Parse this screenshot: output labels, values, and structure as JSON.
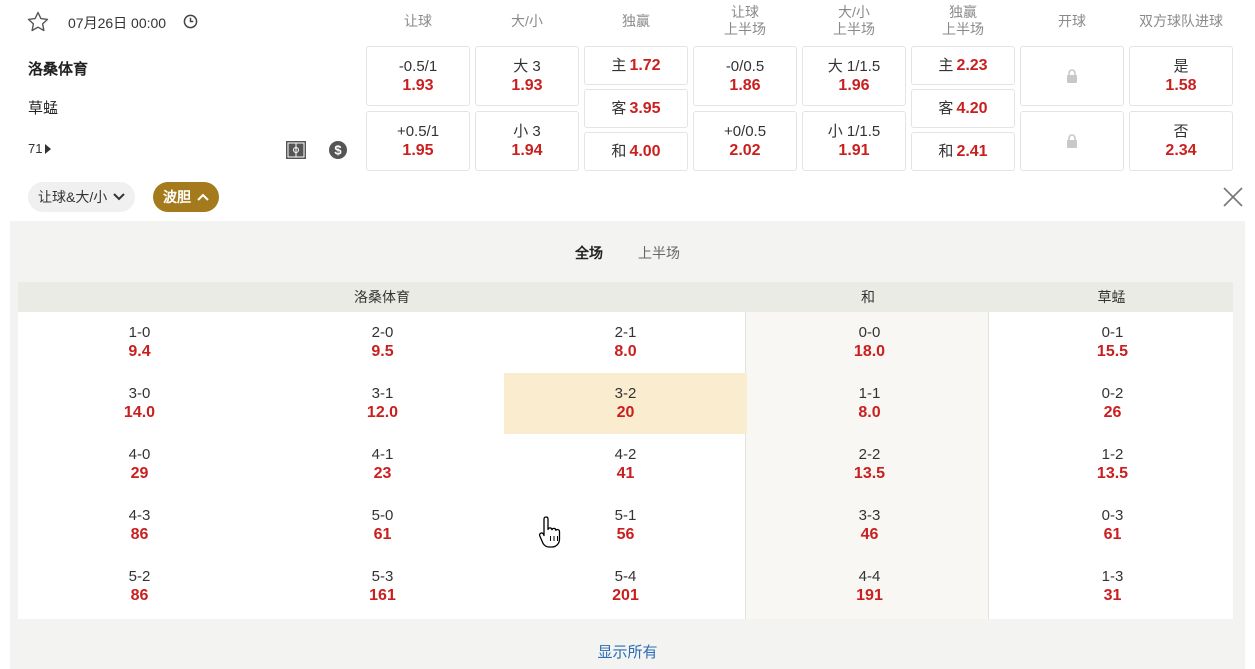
{
  "match": {
    "datetime": "07月26日 00:00",
    "home_team": "洛桑体育",
    "away_team": "草蜢",
    "more_markets_count": "71"
  },
  "columns": {
    "handicap": "让球",
    "total": "大/小",
    "moneyline": "独赢",
    "handicap_1h_a": "让球",
    "handicap_1h_b": "上半场",
    "total_1h_a": "大/小",
    "total_1h_b": "上半场",
    "moneyline_1h_a": "独赢",
    "moneyline_1h_b": "上半场",
    "kickoff": "开球",
    "btts": "双方球队进球"
  },
  "odds": {
    "handicap": [
      {
        "line": "-0.5/1",
        "odd": "1.93"
      },
      {
        "line": "+0.5/1",
        "odd": "1.95"
      }
    ],
    "total": [
      {
        "line": "大 3",
        "odd": "1.93"
      },
      {
        "line": "小 3",
        "odd": "1.94"
      }
    ],
    "moneyline": [
      {
        "line": "主",
        "odd": "1.72"
      },
      {
        "line": "客",
        "odd": "3.95"
      },
      {
        "line": "和",
        "odd": "4.00"
      }
    ],
    "handicap_1h": [
      {
        "line": "-0/0.5",
        "odd": "1.86"
      },
      {
        "line": "+0/0.5",
        "odd": "2.02"
      }
    ],
    "total_1h": [
      {
        "line": "大 1/1.5",
        "odd": "1.96"
      },
      {
        "line": "小 1/1.5",
        "odd": "1.91"
      }
    ],
    "moneyline_1h": [
      {
        "line": "主",
        "odd": "2.23"
      },
      {
        "line": "客",
        "odd": "4.20"
      },
      {
        "line": "和",
        "odd": "2.41"
      }
    ],
    "btts": [
      {
        "line": "是",
        "odd": "1.58"
      },
      {
        "line": "否",
        "odd": "2.34"
      }
    ]
  },
  "chips": {
    "chip1": "让球&大/小",
    "chip2": "波胆"
  },
  "period_tabs": {
    "full": "全场",
    "first_half": "上半场"
  },
  "correct_score": {
    "header_home": "洛桑体育",
    "header_draw": "和",
    "header_away": "草蜢",
    "home": [
      [
        {
          "s": "1-0",
          "o": "9.4"
        },
        {
          "s": "2-0",
          "o": "9.5"
        },
        {
          "s": "2-1",
          "o": "8.0"
        }
      ],
      [
        {
          "s": "3-0",
          "o": "14.0"
        },
        {
          "s": "3-1",
          "o": "12.0"
        },
        {
          "s": "3-2",
          "o": "20"
        }
      ],
      [
        {
          "s": "4-0",
          "o": "29"
        },
        {
          "s": "4-1",
          "o": "23"
        },
        {
          "s": "4-2",
          "o": "41"
        }
      ],
      [
        {
          "s": "4-3",
          "o": "86"
        },
        {
          "s": "5-0",
          "o": "61"
        },
        {
          "s": "5-1",
          "o": "56"
        }
      ],
      [
        {
          "s": "5-2",
          "o": "86"
        },
        {
          "s": "5-3",
          "o": "161"
        },
        {
          "s": "5-4",
          "o": "201"
        }
      ]
    ],
    "draw": [
      {
        "s": "0-0",
        "o": "18.0"
      },
      {
        "s": "1-1",
        "o": "8.0"
      },
      {
        "s": "2-2",
        "o": "13.5"
      },
      {
        "s": "3-3",
        "o": "46"
      },
      {
        "s": "4-4",
        "o": "191"
      }
    ],
    "away": [
      {
        "s": "0-1",
        "o": "15.5"
      },
      {
        "s": "0-2",
        "o": "26"
      },
      {
        "s": "1-2",
        "o": "13.5"
      },
      {
        "s": "0-3",
        "o": "61"
      },
      {
        "s": "1-3",
        "o": "31"
      }
    ]
  },
  "show_all": "显示所有",
  "colors": {
    "odds_red": "#c91f1f",
    "chip_gold": "#a57a1d",
    "highlight": "#faedcf",
    "link_blue": "#2a6db5"
  }
}
